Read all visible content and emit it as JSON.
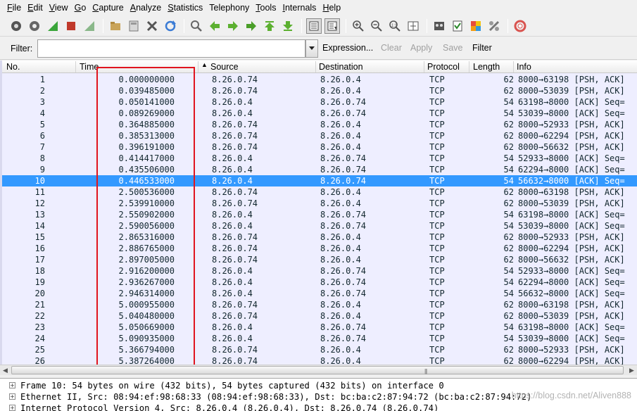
{
  "menu": [
    {
      "first": "F",
      "rest": "ile"
    },
    {
      "first": "E",
      "rest": "dit"
    },
    {
      "first": "V",
      "rest": "iew"
    },
    {
      "first": "G",
      "rest": "o"
    },
    {
      "first": "C",
      "rest": "apture"
    },
    {
      "first": "A",
      "rest": "nalyze"
    },
    {
      "first": "S",
      "rest": "tatistics"
    },
    {
      "first": "",
      "rest": "Telephony"
    },
    {
      "first": "T",
      "rest": "ools"
    },
    {
      "first": "I",
      "rest": "nternals"
    },
    {
      "first": "H",
      "rest": "elp"
    }
  ],
  "toolbar": {
    "icons": [
      "interfaces-icon",
      "options-icon",
      "start-capture-icon",
      "stop-capture-icon",
      "restart-capture-icon",
      "open-file-icon",
      "save-file-icon",
      "close-file-icon",
      "reload-icon",
      "find-icon",
      "back-icon",
      "forward-icon",
      "go-to-icon",
      "first-packet-icon",
      "last-packet-icon",
      "colorize-icon",
      "autoscroll-icon",
      "zoom-in-icon",
      "zoom-out-icon",
      "zoom-normal-icon",
      "resize-columns-icon",
      "capture-filters-icon",
      "display-filters-icon",
      "coloring-rules-icon",
      "preferences-icon",
      "help-icon"
    ]
  },
  "filter": {
    "label": "Filter:",
    "value": "",
    "expression": "Expression...",
    "clear": "Clear",
    "apply": "Apply",
    "save": "Save",
    "filter_btn": "Filter"
  },
  "columns": {
    "no": "No.",
    "time": "Time",
    "source": "Source",
    "destination": "Destination",
    "protocol": "Protocol",
    "length": "Length",
    "info": "Info"
  },
  "packets": [
    {
      "no": "1",
      "time": "0.000000000",
      "src": "8.26.0.74",
      "dst": "8.26.0.4",
      "proto": "TCP",
      "len": "62",
      "info": "8000→63198 [PSH, ACK]"
    },
    {
      "no": "2",
      "time": "0.039485000",
      "src": "8.26.0.74",
      "dst": "8.26.0.4",
      "proto": "TCP",
      "len": "62",
      "info": "8000→53039 [PSH, ACK]"
    },
    {
      "no": "3",
      "time": "0.050141000",
      "src": "8.26.0.4",
      "dst": "8.26.0.74",
      "proto": "TCP",
      "len": "54",
      "info": "63198→8000 [ACK] Seq="
    },
    {
      "no": "4",
      "time": "0.089269000",
      "src": "8.26.0.4",
      "dst": "8.26.0.74",
      "proto": "TCP",
      "len": "54",
      "info": "53039→8000 [ACK] Seq="
    },
    {
      "no": "5",
      "time": "0.364885000",
      "src": "8.26.0.74",
      "dst": "8.26.0.4",
      "proto": "TCP",
      "len": "62",
      "info": "8000→52933 [PSH, ACK]"
    },
    {
      "no": "6",
      "time": "0.385313000",
      "src": "8.26.0.74",
      "dst": "8.26.0.4",
      "proto": "TCP",
      "len": "62",
      "info": "8000→62294 [PSH, ACK]"
    },
    {
      "no": "7",
      "time": "0.396191000",
      "src": "8.26.0.74",
      "dst": "8.26.0.4",
      "proto": "TCP",
      "len": "62",
      "info": "8000→56632 [PSH, ACK]"
    },
    {
      "no": "8",
      "time": "0.414417000",
      "src": "8.26.0.4",
      "dst": "8.26.0.74",
      "proto": "TCP",
      "len": "54",
      "info": "52933→8000 [ACK] Seq="
    },
    {
      "no": "9",
      "time": "0.435506000",
      "src": "8.26.0.4",
      "dst": "8.26.0.74",
      "proto": "TCP",
      "len": "54",
      "info": "62294→8000 [ACK] Seq="
    },
    {
      "no": "10",
      "time": "0.446533000",
      "src": "8.26.0.4",
      "dst": "8.26.0.74",
      "proto": "TCP",
      "len": "54",
      "info": "56632→8000 [ACK] Seq=",
      "selected": true
    },
    {
      "no": "11",
      "time": "2.500536000",
      "src": "8.26.0.74",
      "dst": "8.26.0.4",
      "proto": "TCP",
      "len": "62",
      "info": "8000→63198 [PSH, ACK]"
    },
    {
      "no": "12",
      "time": "2.539910000",
      "src": "8.26.0.74",
      "dst": "8.26.0.4",
      "proto": "TCP",
      "len": "62",
      "info": "8000→53039 [PSH, ACK]"
    },
    {
      "no": "13",
      "time": "2.550902000",
      "src": "8.26.0.4",
      "dst": "8.26.0.74",
      "proto": "TCP",
      "len": "54",
      "info": "63198→8000 [ACK] Seq="
    },
    {
      "no": "14",
      "time": "2.590056000",
      "src": "8.26.0.4",
      "dst": "8.26.0.74",
      "proto": "TCP",
      "len": "54",
      "info": "53039→8000 [ACK] Seq="
    },
    {
      "no": "15",
      "time": "2.865316000",
      "src": "8.26.0.74",
      "dst": "8.26.0.4",
      "proto": "TCP",
      "len": "62",
      "info": "8000→52933 [PSH, ACK]"
    },
    {
      "no": "16",
      "time": "2.886765000",
      "src": "8.26.0.74",
      "dst": "8.26.0.4",
      "proto": "TCP",
      "len": "62",
      "info": "8000→62294 [PSH, ACK]"
    },
    {
      "no": "17",
      "time": "2.897005000",
      "src": "8.26.0.74",
      "dst": "8.26.0.4",
      "proto": "TCP",
      "len": "62",
      "info": "8000→56632 [PSH, ACK]"
    },
    {
      "no": "18",
      "time": "2.916200000",
      "src": "8.26.0.4",
      "dst": "8.26.0.74",
      "proto": "TCP",
      "len": "54",
      "info": "52933→8000 [ACK] Seq="
    },
    {
      "no": "19",
      "time": "2.936267000",
      "src": "8.26.0.4",
      "dst": "8.26.0.74",
      "proto": "TCP",
      "len": "54",
      "info": "62294→8000 [ACK] Seq="
    },
    {
      "no": "20",
      "time": "2.946314000",
      "src": "8.26.0.4",
      "dst": "8.26.0.74",
      "proto": "TCP",
      "len": "54",
      "info": "56632→8000 [ACK] Seq="
    },
    {
      "no": "21",
      "time": "5.000955000",
      "src": "8.26.0.74",
      "dst": "8.26.0.4",
      "proto": "TCP",
      "len": "62",
      "info": "8000→63198 [PSH, ACK]"
    },
    {
      "no": "22",
      "time": "5.040480000",
      "src": "8.26.0.74",
      "dst": "8.26.0.4",
      "proto": "TCP",
      "len": "62",
      "info": "8000→53039 [PSH, ACK]"
    },
    {
      "no": "23",
      "time": "5.050669000",
      "src": "8.26.0.4",
      "dst": "8.26.0.74",
      "proto": "TCP",
      "len": "54",
      "info": "63198→8000 [ACK] Seq="
    },
    {
      "no": "24",
      "time": "5.090935000",
      "src": "8.26.0.4",
      "dst": "8.26.0.74",
      "proto": "TCP",
      "len": "54",
      "info": "53039→8000 [ACK] Seq="
    },
    {
      "no": "25",
      "time": "5.366794000",
      "src": "8.26.0.74",
      "dst": "8.26.0.4",
      "proto": "TCP",
      "len": "62",
      "info": "8000→52933 [PSH, ACK]"
    },
    {
      "no": "26",
      "time": "5.387264000",
      "src": "8.26.0.74",
      "dst": "8.26.0.4",
      "proto": "TCP",
      "len": "62",
      "info": "8000→62294 [PSH, ACK]"
    }
  ],
  "details": [
    "Frame 10: 54 bytes on wire (432 bits), 54 bytes captured (432 bits) on interface 0",
    "Ethernet II, Src: 08:94:ef:98:68:33 (08:94:ef:98:68:33), Dst: bc:ba:c2:87:94:72 (bc:ba:c2:87:94:72)",
    "Internet Protocol Version 4, Src: 8.26.0.4 (8.26.0.4), Dst: 8.26.0.74 (8.26.0.74)"
  ],
  "watermark": "https://blog.csdn.net/Aliven888",
  "colors": {
    "row_bg": "#eeeeff",
    "selected_row": "#3399ff",
    "annotation": "#e0141e"
  }
}
